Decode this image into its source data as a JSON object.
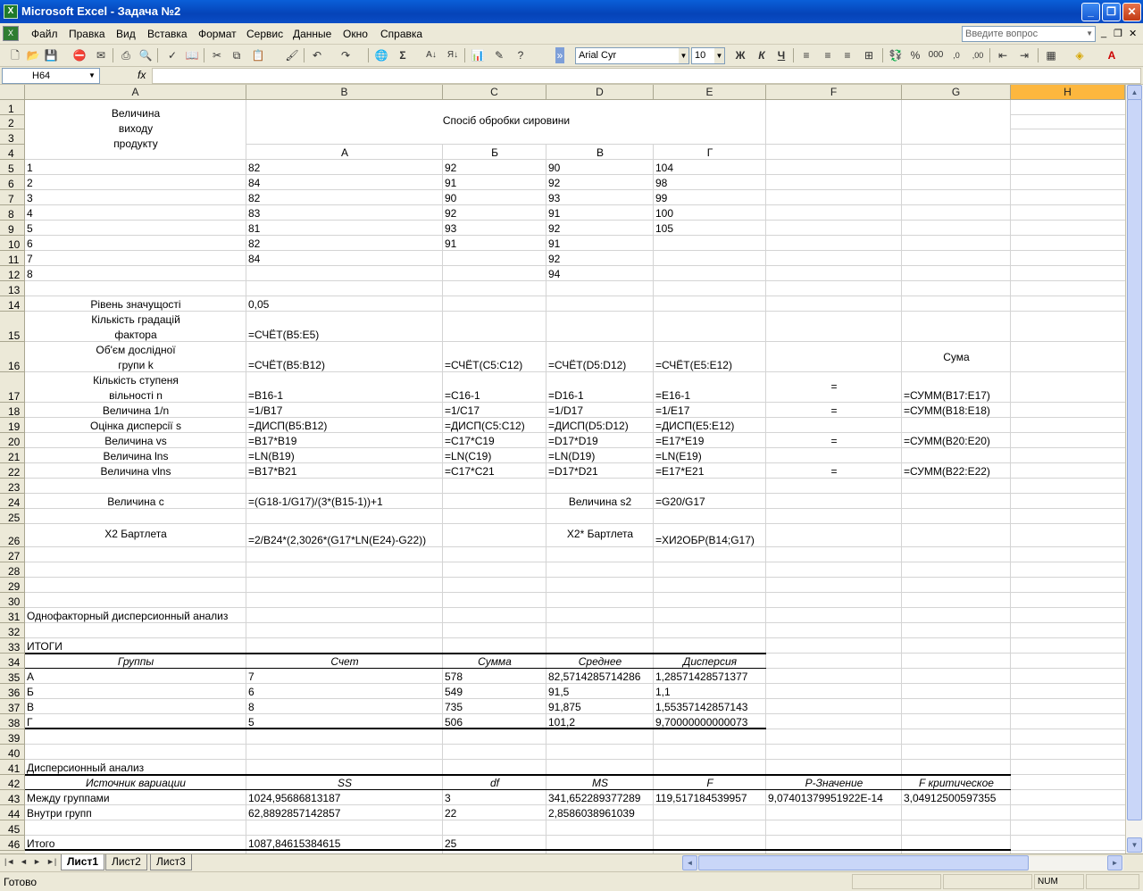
{
  "window": {
    "title": "Microsoft Excel - Задача №2"
  },
  "menu": {
    "items": [
      "Файл",
      "Правка",
      "Вид",
      "Вставка",
      "Формат",
      "Сервис",
      "Данные",
      "Окно",
      "Справка"
    ],
    "ask_placeholder": "Введите вопрос"
  },
  "toolbar": {
    "font": "Arial Cyr",
    "size": "10",
    "bold": "Ж",
    "italic": "К",
    "underline": "Ч",
    "percent": "%",
    "thousands": "000"
  },
  "formula": {
    "name_box": "H64",
    "fx": "fx",
    "content": ""
  },
  "columns": [
    "A",
    "B",
    "C",
    "D",
    "E",
    "F",
    "G",
    "H"
  ],
  "rows": [
    "1",
    "2",
    "3",
    "4",
    "5",
    "6",
    "7",
    "8",
    "9",
    "10",
    "11",
    "12",
    "13",
    "14",
    "15",
    "16",
    "17",
    "18",
    "19",
    "20",
    "21",
    "22",
    "23",
    "24",
    "25",
    "26",
    "27",
    "28",
    "29",
    "30",
    "31",
    "32",
    "33",
    "34",
    "35",
    "36",
    "37",
    "38",
    "39",
    "40",
    "41",
    "42",
    "43",
    "44",
    "45",
    "46"
  ],
  "cells": {
    "a1": "Величина",
    "a2": "виходу",
    "a3": "продукту",
    "b2": "Спосіб обробки сировини",
    "b4": "А",
    "c4": "Б",
    "d4": "В",
    "e4": "Г",
    "table": [
      [
        "1",
        "82",
        "92",
        "90",
        "104"
      ],
      [
        "2",
        "84",
        "91",
        "92",
        "98"
      ],
      [
        "3",
        "82",
        "90",
        "93",
        "99"
      ],
      [
        "4",
        "83",
        "92",
        "91",
        "100"
      ],
      [
        "5",
        "81",
        "93",
        "92",
        "105"
      ],
      [
        "6",
        "82",
        "91",
        "91",
        ""
      ],
      [
        "7",
        "84",
        "",
        "92",
        ""
      ],
      [
        "8",
        "",
        "",
        "94",
        ""
      ]
    ],
    "a14": "Рівень значущості",
    "b14": "0,05",
    "a15a": "Кількість градацій",
    "a15b": "фактора",
    "b15": "=СЧЁТ(B5:E5)",
    "a16a": "Об'єм дослідної",
    "a16b": "групи k",
    "b16": "=СЧЁТ(B5:B12)",
    "c16": "=СЧЁТ(C5:C12)",
    "d16": "=СЧЁТ(D5:D12)",
    "e16": "=СЧЁТ(E5:E12)",
    "g16": "Сума",
    "a17a": "Кількість ступеня",
    "a17b": "вільності n",
    "b17": "=B16-1",
    "c17": "=C16-1",
    "d17": "=D16-1",
    "e17": "=E16-1",
    "f17": "=",
    "g17": "=СУММ(B17:E17)",
    "a18": "Величина 1/n",
    "b18": "=1/B17",
    "c18": "=1/C17",
    "d18": "=1/D17",
    "e18": "=1/E17",
    "f18": "=",
    "g18": "=СУММ(B18:E18)",
    "a19": "Оцінка дисперсії s",
    "b19": "=ДИСП(B5:B12)",
    "c19": "=ДИСП(C5:C12)",
    "d19": "=ДИСП(D5:D12)",
    "e19": "=ДИСП(E5:E12)",
    "a20": "Величина vs",
    "b20": "=B17*B19",
    "c20": "=C17*C19",
    "d20": "=D17*D19",
    "e20": "=E17*E19",
    "f20": "=",
    "g20": "=СУММ(B20:E20)",
    "a21": "Величина lns",
    "b21": "=LN(B19)",
    "c21": "=LN(C19)",
    "d21": "=LN(D19)",
    "e21": "=LN(E19)",
    "a22": "Величина vlns",
    "b22": "=B17*B21",
    "c22": "=C17*C21",
    "d22": "=D17*D21",
    "e22": "=E17*E21",
    "f22": "=",
    "g22": "=СУММ(B22:E22)",
    "a24": "Величина c",
    "b24": "=(G18-1/G17)/(3*(B15-1))+1",
    "d24": "Величина s2",
    "e24": "=G20/G17",
    "a26": "X2 Бартлета",
    "b26": "=2/B24*(2,3026*(G17*LN(E24)-G22))",
    "d26": "X2* Бартлета",
    "e26": "=ХИ2ОБР(B14;G17)",
    "a31": "Однофакторный дисперсионный анализ",
    "a33": "ИТОГИ",
    "summary_headers": [
      "Группы",
      "Счет",
      "Сумма",
      "Среднее",
      "Дисперсия"
    ],
    "summary": [
      [
        "А",
        "7",
        "578",
        "82,5714285714286",
        "1,28571428571377"
      ],
      [
        "Б",
        "6",
        "549",
        "91,5",
        "1,1"
      ],
      [
        "В",
        "8",
        "735",
        "91,875",
        "1,55357142857143"
      ],
      [
        "Г",
        "5",
        "506",
        "101,2",
        "9,70000000000073"
      ]
    ],
    "a41": "Дисперсионный анализ",
    "anova_headers": [
      "Источник вариации",
      "SS",
      "df",
      "MS",
      "F",
      "P-Значение",
      "F критическое"
    ],
    "anova": [
      [
        "Между группами",
        "1024,95686813187",
        "3",
        "341,652289377289",
        "119,517184539957",
        "9,07401379951922E-14",
        "3,04912500597355"
      ],
      [
        "Внутри групп",
        "62,8892857142857",
        "22",
        "2,8586038961039",
        "",
        "",
        ""
      ],
      [
        "Итого",
        "1087,84615384615",
        "25",
        "",
        "",
        "",
        ""
      ]
    ]
  },
  "sheets": [
    "Лист1",
    "Лист2",
    "Лист3"
  ],
  "status": {
    "ready": "Готово",
    "num": "NUM"
  }
}
